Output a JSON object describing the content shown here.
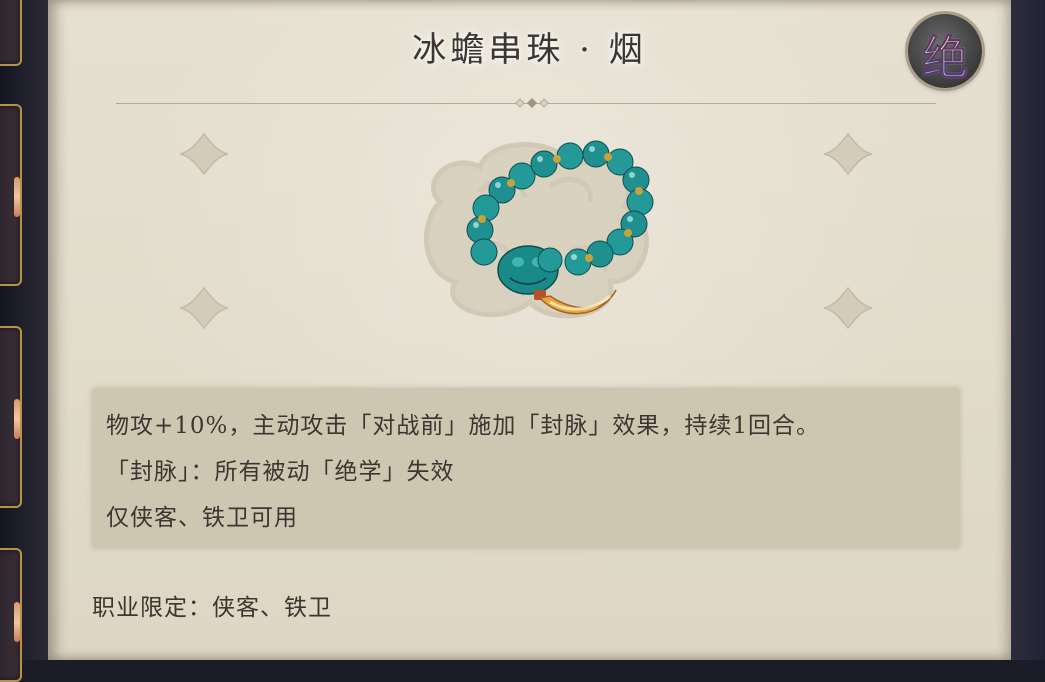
{
  "item": {
    "title": "冰蟾串珠 · 烟",
    "rarity": "绝",
    "image_icon": "jade-bead-bracelet-icon"
  },
  "description": {
    "lines": [
      "物攻+10%，主动攻击「对战前」施加「封脉」效果，持续1回合。",
      "「封脉」：所有被动「绝学」失效",
      "仅侠客、铁卫可用"
    ]
  },
  "requirement": {
    "text": "职业限定：侠客、铁卫"
  },
  "colors": {
    "parchment": "#e2dccb",
    "text": "#3b3630",
    "bead": "#1f8f8f",
    "gold": "#c9a23a"
  }
}
